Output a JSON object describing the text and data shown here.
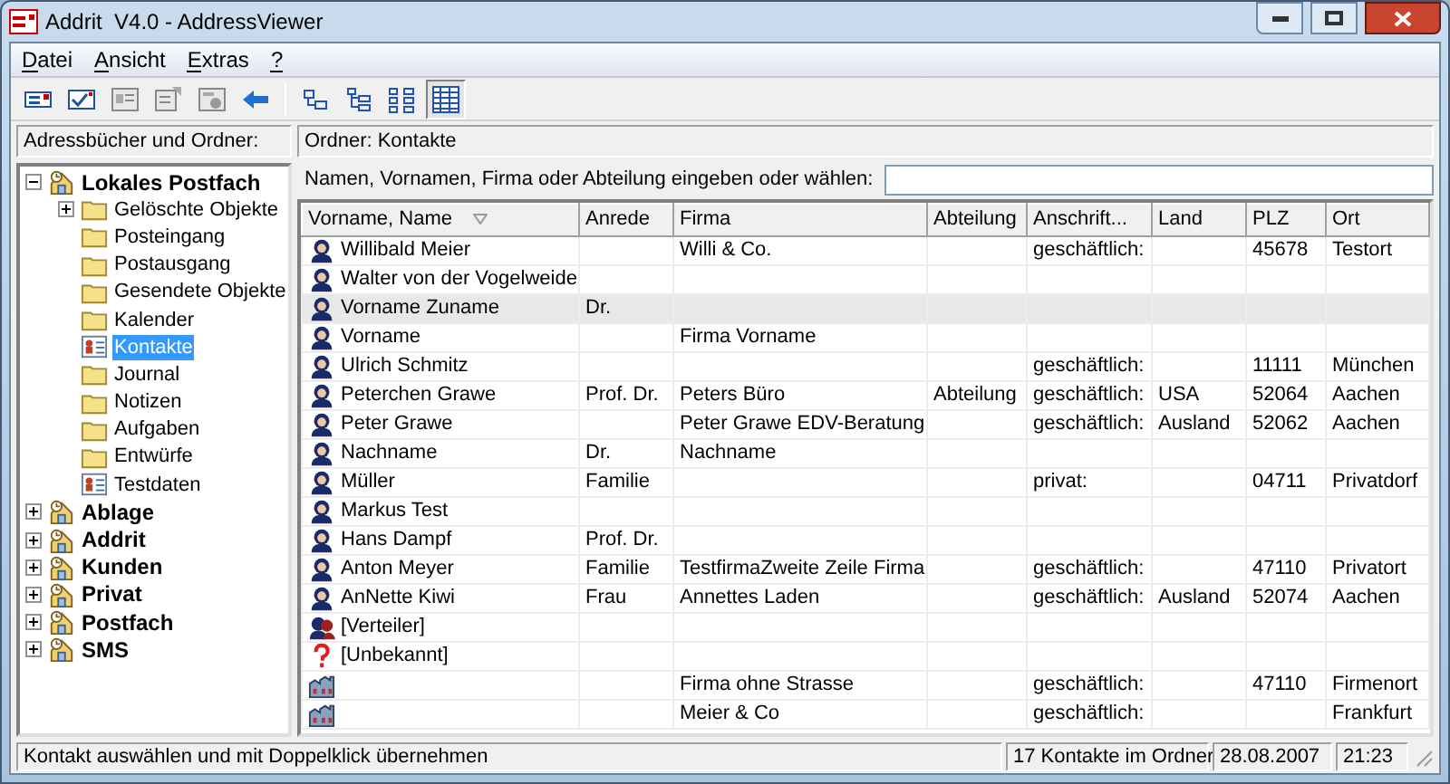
{
  "window": {
    "title": "Addrit  V4.0 - AddressViewer"
  },
  "menu": [
    {
      "label": "Datei"
    },
    {
      "label": "Ansicht"
    },
    {
      "label": "Extras"
    },
    {
      "label": "?"
    }
  ],
  "toolbar": [
    {
      "kind": "new",
      "selected": false
    },
    {
      "kind": "check",
      "selected": false
    },
    {
      "kind": "card",
      "selected": false
    },
    {
      "kind": "edit",
      "selected": false
    },
    {
      "kind": "import",
      "selected": false
    },
    {
      "kind": "back",
      "selected": false
    },
    {
      "kind": "separator"
    },
    {
      "kind": "tree1",
      "selected": false
    },
    {
      "kind": "tree2",
      "selected": false
    },
    {
      "kind": "tree3",
      "selected": false
    },
    {
      "kind": "grid",
      "selected": true
    }
  ],
  "left_header": "Adressbücher und Ordner:",
  "right_header": "Ordner: Kontakte",
  "search": {
    "label": "Namen, Vornamen, Firma oder Abteilung eingeben oder wählen:"
  },
  "tree": [
    {
      "label": "Lokales Postfach",
      "kind": "mailbox",
      "expanded": true,
      "selected": false,
      "children": [
        {
          "label": "Gelöschte Objekte",
          "kind": "folder",
          "expanded": false,
          "selected": false
        },
        {
          "label": "Posteingang",
          "kind": "folder",
          "selected": false
        },
        {
          "label": "Postausgang",
          "kind": "folder",
          "selected": false
        },
        {
          "label": "Gesendete Objekte",
          "kind": "folder",
          "selected": false
        },
        {
          "label": "Kalender",
          "kind": "folder",
          "selected": false
        },
        {
          "label": "Kontakte",
          "kind": "contacts",
          "selected": true
        },
        {
          "label": "Journal",
          "kind": "folder",
          "selected": false
        },
        {
          "label": "Notizen",
          "kind": "folder",
          "selected": false
        },
        {
          "label": "Aufgaben",
          "kind": "folder",
          "selected": false
        },
        {
          "label": "Entwürfe",
          "kind": "folder",
          "selected": false
        },
        {
          "label": "Testdaten",
          "kind": "contacts",
          "selected": false
        }
      ]
    },
    {
      "label": "Ablage",
      "kind": "mailbox",
      "expanded": false,
      "selected": false
    },
    {
      "label": "Addrit",
      "kind": "mailbox",
      "expanded": false,
      "selected": false
    },
    {
      "label": "Kunden",
      "kind": "mailbox",
      "expanded": false,
      "selected": false
    },
    {
      "label": "Privat",
      "kind": "mailbox",
      "expanded": false,
      "selected": false
    },
    {
      "label": "Postfach",
      "kind": "mailbox",
      "expanded": false,
      "selected": false
    },
    {
      "label": "SMS",
      "kind": "mailbox",
      "expanded": false,
      "selected": false
    }
  ],
  "table": {
    "columns": [
      {
        "label": "Vorname, Name",
        "sorted": true
      },
      {
        "label": "Anrede",
        "sorted": false
      },
      {
        "label": "Firma",
        "sorted": false
      },
      {
        "label": "Abteilung",
        "sorted": false
      },
      {
        "label": "Anschrift...",
        "sorted": false
      },
      {
        "label": "Land",
        "sorted": false
      },
      {
        "label": "PLZ",
        "sorted": false
      },
      {
        "label": "Ort",
        "sorted": false
      }
    ],
    "rows": [
      {
        "kind": "person",
        "selected": false,
        "cells": [
          "Willibald Meier",
          null,
          "Willi & Co.",
          null,
          "geschäftlich:",
          null,
          "45678",
          "Testort"
        ]
      },
      {
        "kind": "person",
        "selected": false,
        "cells": [
          "Walter von der Vogelweide",
          null,
          null,
          null,
          null,
          null,
          null,
          null
        ]
      },
      {
        "kind": "person",
        "selected": true,
        "cells": [
          "Vorname Zuname",
          "Dr.",
          null,
          null,
          null,
          null,
          null,
          null
        ]
      },
      {
        "kind": "person",
        "selected": false,
        "cells": [
          "Vorname",
          null,
          "Firma Vorname",
          null,
          null,
          null,
          null,
          null
        ]
      },
      {
        "kind": "person",
        "selected": false,
        "cells": [
          "Ulrich Schmitz",
          null,
          null,
          null,
          "geschäftlich:",
          null,
          "11111",
          "München"
        ]
      },
      {
        "kind": "person",
        "selected": false,
        "cells": [
          "Peterchen Grawe",
          "Prof. Dr.",
          "Peters Büro",
          "Abteilung",
          "geschäftlich:",
          "USA",
          "52064",
          "Aachen"
        ]
      },
      {
        "kind": "person",
        "selected": false,
        "cells": [
          "Peter Grawe",
          null,
          "Peter Grawe EDV-Beratung",
          null,
          "geschäftlich:",
          "Ausland",
          "52062",
          "Aachen"
        ]
      },
      {
        "kind": "person",
        "selected": false,
        "cells": [
          "Nachname",
          "Dr.",
          "Nachname",
          null,
          null,
          null,
          null,
          null
        ]
      },
      {
        "kind": "person",
        "selected": false,
        "cells": [
          "Müller",
          "Familie",
          null,
          null,
          "privat:",
          null,
          "04711",
          "Privatdorf"
        ]
      },
      {
        "kind": "person",
        "selected": false,
        "cells": [
          "Markus Test",
          null,
          null,
          null,
          null,
          null,
          null,
          null
        ]
      },
      {
        "kind": "person",
        "selected": false,
        "cells": [
          "Hans Dampf",
          "Prof. Dr.",
          null,
          null,
          null,
          null,
          null,
          null
        ]
      },
      {
        "kind": "person",
        "selected": false,
        "cells": [
          "Anton Meyer",
          "Familie",
          "TestfirmaZweite Zeile Firma",
          null,
          "geschäftlich:",
          null,
          "47110",
          "Privatort"
        ]
      },
      {
        "kind": "person",
        "selected": false,
        "cells": [
          "AnNette Kiwi",
          "Frau",
          "Annettes Laden",
          null,
          "geschäftlich:",
          "Ausland",
          "52074",
          "Aachen"
        ]
      },
      {
        "kind": "group",
        "selected": false,
        "cells": [
          "[Verteiler]",
          null,
          null,
          null,
          null,
          null,
          null,
          null
        ]
      },
      {
        "kind": "unknown",
        "selected": false,
        "cells": [
          "[Unbekannt]",
          null,
          null,
          null,
          null,
          null,
          null,
          null
        ]
      },
      {
        "kind": "company",
        "selected": false,
        "cells": [
          null,
          null,
          "Firma ohne Strasse",
          null,
          "geschäftlich:",
          null,
          "47110",
          "Firmenort"
        ]
      },
      {
        "kind": "company",
        "selected": false,
        "cells": [
          null,
          null,
          "Meier & Co",
          null,
          "geschäftlich:",
          null,
          null,
          "Frankfurt"
        ]
      }
    ]
  },
  "status_bar": {
    "message": "Kontakt auswählen und mit Doppelklick übernehmen",
    "count": "17 Kontakte im Ordner",
    "date": "28.08.2007",
    "time": "21:23"
  }
}
